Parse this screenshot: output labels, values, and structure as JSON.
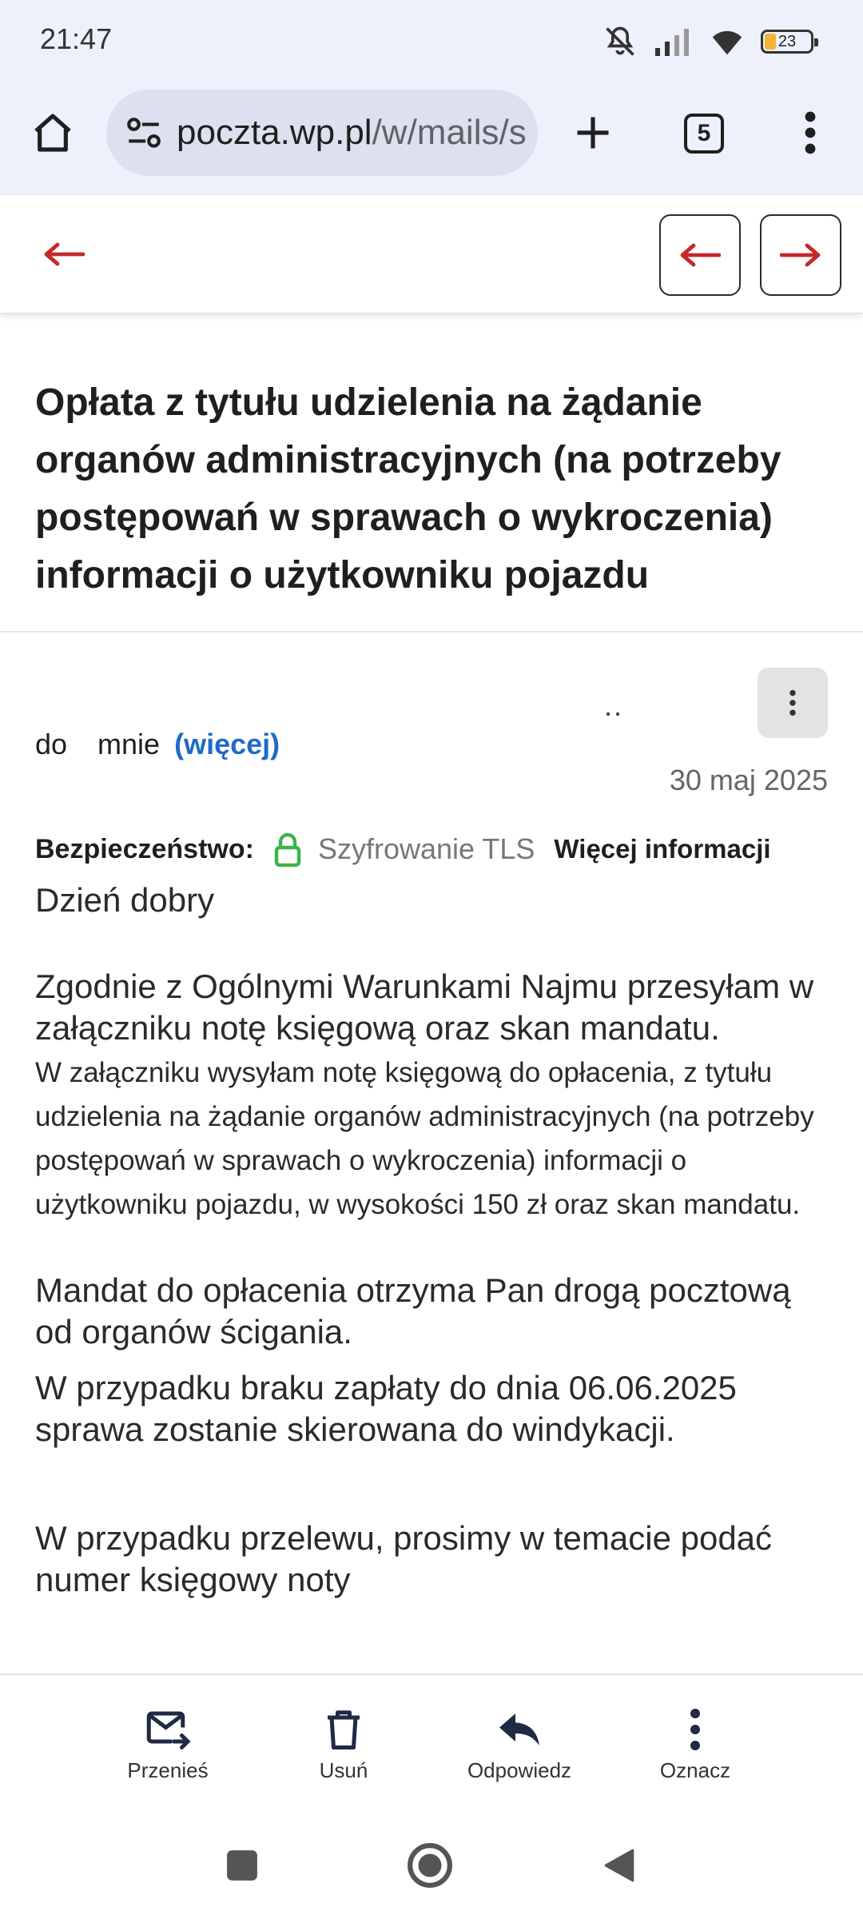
{
  "status_bar": {
    "time": "21:47",
    "battery": "23"
  },
  "browser": {
    "url_host": "poczta.wp.pl",
    "url_path": "/w/mails/s",
    "tab_count": "5"
  },
  "mail": {
    "subject": "Opłata z tytułu udzielenia na żądanie organów administracyjnych (na potrzeby postępowań w sprawach o wykroczenia) informacji o użytkowniku pojazdu",
    "dots": "..",
    "to_label": "do",
    "to_value": "mnie",
    "more_link": "(więcej)",
    "date": "30 maj 2025",
    "security_label": "Bezpieczeństwo:",
    "security_value": "Szyfrowanie TLS",
    "security_more": "Więcej informacji",
    "body": {
      "greeting": "Dzień dobry",
      "p1": "Zgodnie z Ogólnymi Warunkami Najmu przesyłam w załączniku notę księgową oraz skan mandatu.",
      "p1_small": "W załączniku wysyłam notę księgową do opłacenia, z tytułu udzielenia na żądanie organów administracyjnych (na potrzeby postępowań w sprawach o wykroczenia) informacji o użytkowniku pojazdu, w wysokości 150 zł oraz skan mandatu.",
      "p2": "Mandat do opłacenia otrzyma Pan drogą pocztową od organów ścigania.",
      "p3": "W przypadku braku zapłaty do dnia 06.06.2025 sprawa zostanie skierowana do windykacji.",
      "p4": "W przypadku przelewu, prosimy w temacie podać numer księgowy noty"
    }
  },
  "actions": {
    "move": "Przenieś",
    "delete": "Usuń",
    "reply": "Odpowiedz",
    "mark": "Oznacz"
  },
  "colors": {
    "accent_red": "#c62828",
    "link_blue": "#1f6ac8",
    "lock_green": "#3cb44b"
  }
}
